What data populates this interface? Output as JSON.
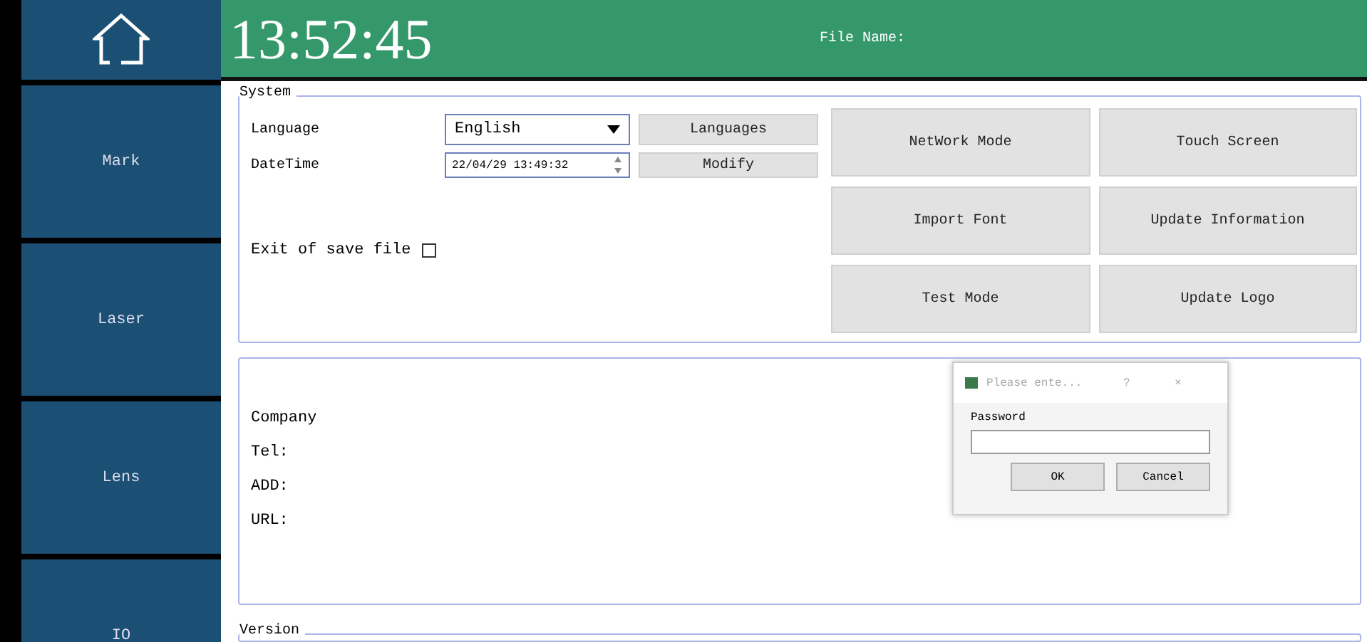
{
  "header": {
    "time": "13:52:45",
    "file_name_label": "File Name:"
  },
  "sidebar": {
    "items": [
      {
        "label": "Mark",
        "selected": false
      },
      {
        "label": "Laser",
        "selected": false
      },
      {
        "label": "Lens",
        "selected": false
      },
      {
        "label": "IO",
        "selected": false
      }
    ]
  },
  "system": {
    "title": "System",
    "language_label": "Language",
    "language_value": "English",
    "languages_button": "Languages",
    "datetime_label": "DateTime",
    "datetime_value": "22/04/29 13:49:32",
    "modify_button": "Modify",
    "exit_save_label": "Exit of save file",
    "exit_save_checked": false,
    "buttons": [
      "NetWork Mode",
      "Touch Screen",
      "Import Font",
      "Update Information",
      "Test Mode",
      "Update Logo"
    ]
  },
  "info": {
    "lines": [
      "Company",
      "Tel:",
      "ADD:",
      "URL:"
    ]
  },
  "version": {
    "title": "Version"
  },
  "dialog": {
    "title": "Please ente...",
    "help": "?",
    "close": "×",
    "field_label": "Password",
    "ok": "OK",
    "cancel": "Cancel"
  }
}
